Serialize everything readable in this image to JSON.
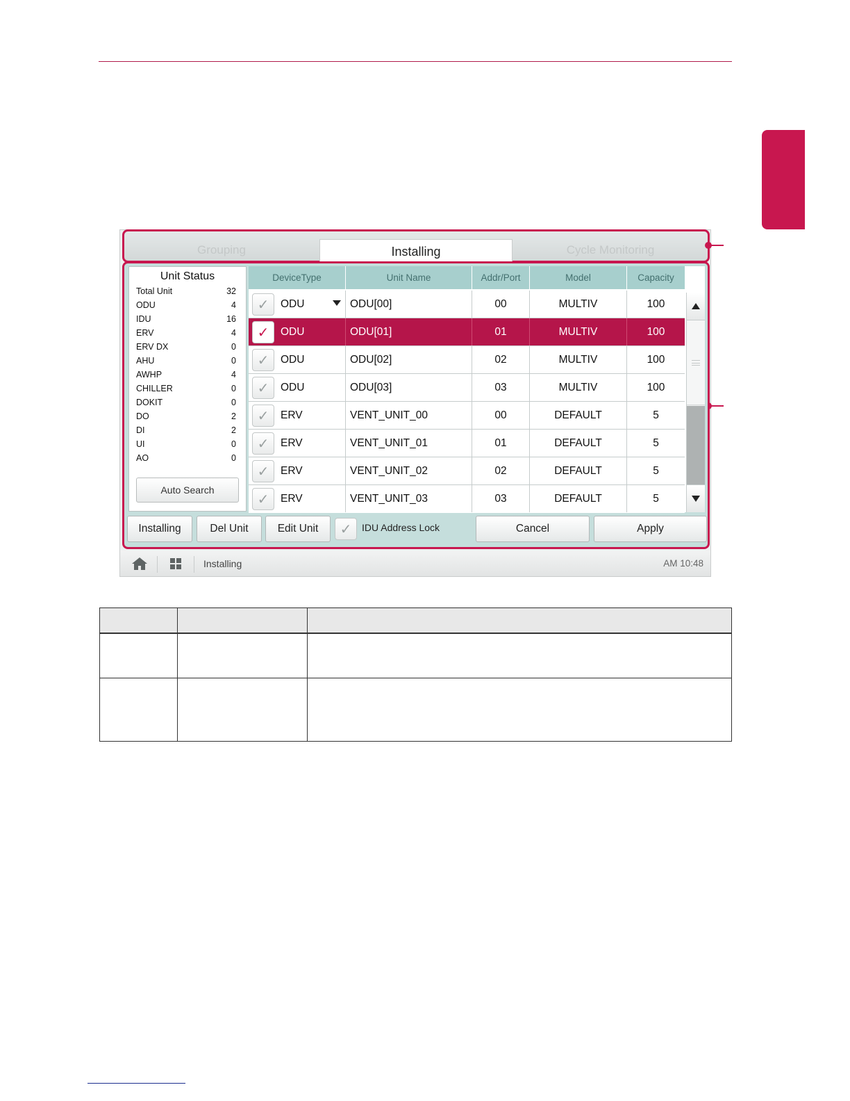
{
  "tabs": [
    {
      "label": "Grouping",
      "active": false
    },
    {
      "label": "Installing",
      "active": true
    },
    {
      "label": "Cycle Monitoring",
      "active": false
    }
  ],
  "unit_status": {
    "title": "Unit Status",
    "rows": [
      {
        "label": "Total Unit",
        "value": "32"
      },
      {
        "label": "ODU",
        "value": "4"
      },
      {
        "label": "IDU",
        "value": "16"
      },
      {
        "label": "ERV",
        "value": "4"
      },
      {
        "label": "ERV DX",
        "value": "0"
      },
      {
        "label": "AHU",
        "value": "0"
      },
      {
        "label": "AWHP",
        "value": "4"
      },
      {
        "label": "CHILLER",
        "value": "0"
      },
      {
        "label": "DOKIT",
        "value": "0"
      },
      {
        "label": "DO",
        "value": "2"
      },
      {
        "label": "DI",
        "value": "2"
      },
      {
        "label": "UI",
        "value": "0"
      },
      {
        "label": "AO",
        "value": "0"
      }
    ],
    "auto_search_label": "Auto Search"
  },
  "table": {
    "headers": [
      "DeviceType",
      "Unit Name",
      "Addr/Port",
      "Model",
      "Capacity"
    ],
    "rows": [
      {
        "device_type": "ODU",
        "unit_name": "ODU[00]",
        "addr": "00",
        "model": "MULTIV",
        "capacity": "100",
        "selected": false,
        "dropdown": true
      },
      {
        "device_type": "ODU",
        "unit_name": "ODU[01]",
        "addr": "01",
        "model": "MULTIV",
        "capacity": "100",
        "selected": true
      },
      {
        "device_type": "ODU",
        "unit_name": "ODU[02]",
        "addr": "02",
        "model": "MULTIV",
        "capacity": "100",
        "selected": false
      },
      {
        "device_type": "ODU",
        "unit_name": "ODU[03]",
        "addr": "03",
        "model": "MULTIV",
        "capacity": "100",
        "selected": false
      },
      {
        "device_type": "ERV",
        "unit_name": "VENT_UNIT_00",
        "addr": "00",
        "model": "DEFAULT",
        "capacity": "5",
        "selected": false
      },
      {
        "device_type": "ERV",
        "unit_name": "VENT_UNIT_01",
        "addr": "01",
        "model": "DEFAULT",
        "capacity": "5",
        "selected": false
      },
      {
        "device_type": "ERV",
        "unit_name": "VENT_UNIT_02",
        "addr": "02",
        "model": "DEFAULT",
        "capacity": "5",
        "selected": false
      },
      {
        "device_type": "ERV",
        "unit_name": "VENT_UNIT_03",
        "addr": "03",
        "model": "DEFAULT",
        "capacity": "5",
        "selected": false
      }
    ]
  },
  "bottom_buttons": {
    "installing": "Installing",
    "del_unit": "Del Unit",
    "edit_unit": "Edit Unit",
    "idu_lock": "IDU Address Lock",
    "cancel": "Cancel",
    "apply": "Apply"
  },
  "status_bar": {
    "title": "Installing",
    "time": "AM 10:48"
  },
  "colors": {
    "accent": "#c8174f",
    "selected_row": "#b5154a",
    "header_bg": "#a7cfcd",
    "panel_bg": "#c5dedc"
  },
  "icons": [
    "home-icon",
    "menu-grid-icon",
    "checkmark-icon",
    "dropdown-arrow-icon",
    "scroll-up-icon",
    "scroll-down-icon"
  ]
}
